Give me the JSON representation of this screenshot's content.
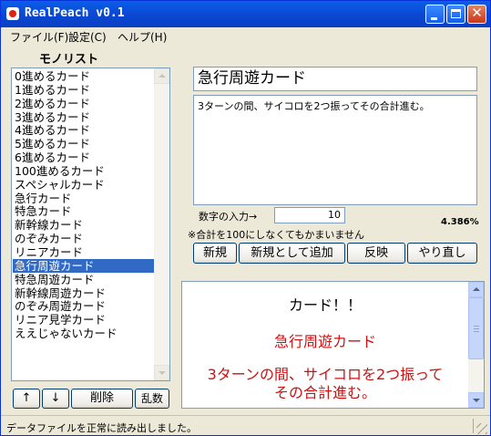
{
  "window": {
    "title": "RealPeach v0.1"
  },
  "menu": [
    {
      "label": "ファイル(F)"
    },
    {
      "label": "設定(C)"
    },
    {
      "label": "ヘルプ(H)"
    }
  ],
  "list": {
    "title": "モノリスト",
    "items": [
      "0進めるカード",
      "1進めるカード",
      "2進めるカード",
      "3進めるカード",
      "4進めるカード",
      "5進めるカード",
      "6進めるカード",
      "100進めるカード",
      "スペシャルカード",
      "急行カード",
      "特急カード",
      "新幹線カード",
      "のぞみカード",
      "リニアカード",
      "急行周遊カード",
      "特急周遊カード",
      "新幹線周遊カード",
      "のぞみ周遊カード",
      "リニア見学カード",
      "ええじゃないカード"
    ],
    "selected_index": 14
  },
  "list_buttons": {
    "up": "↑",
    "down": "↓",
    "delete": "削除",
    "random": "乱数"
  },
  "editor": {
    "title_value": "急行周遊カード",
    "description": "3ターンの間、サイコロを2つ振ってその合計進む。",
    "number_label": "数字の入力→",
    "number_value": "10",
    "note": "※合計を100にしなくてもかまいません",
    "percent": "4.386%"
  },
  "action_buttons": {
    "new": "新規",
    "add_as_new": "新規として追加",
    "apply": "反映",
    "redo": "やり直し"
  },
  "preview": {
    "header": "カード！！",
    "name": "急行周遊カード",
    "desc_line1": "3ターンの間、サイコロを2つ振って",
    "desc_line2": "その合計進む。"
  },
  "status": {
    "text": "データファイルを正常に読み出しました。"
  },
  "colors": {
    "selection": "#316ac5",
    "preview_text": "#d01010",
    "titlebar": "#0b48d4"
  }
}
